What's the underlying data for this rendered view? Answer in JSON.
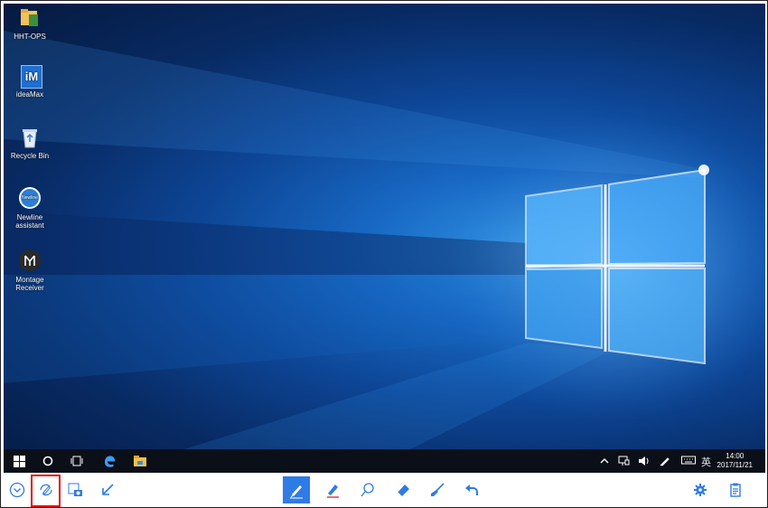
{
  "desktop_icons": [
    {
      "name": "folder-icon",
      "label": "HHT-OPS"
    },
    {
      "name": "ideamax-icon",
      "label": "ideaMax",
      "logo_text": "iM"
    },
    {
      "name": "recycle-bin-icon",
      "label": "Recycle Bin"
    },
    {
      "name": "newline-assistant-icon",
      "label": "Newline\nassistant",
      "logo_text": "Newline"
    },
    {
      "name": "montage-receiver-icon",
      "label": "Montage\nReceiver"
    }
  ],
  "taskbar": {
    "input_method": "英",
    "time": "14:00",
    "date": "2017/11/21"
  },
  "annotation_toolbar": {
    "active_tool": "pen",
    "highlighted_tool": "whiteboard-mode",
    "highlight_color": "#e01010",
    "accent_color": "#2f7be6"
  }
}
